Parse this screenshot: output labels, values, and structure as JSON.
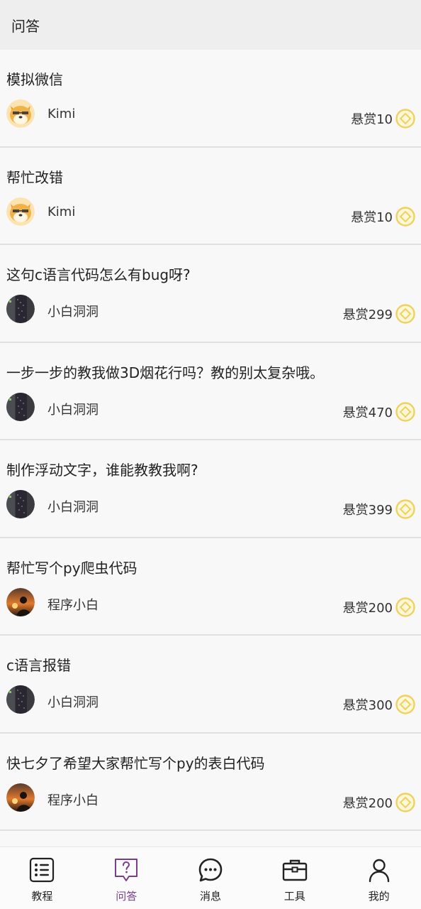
{
  "header": {
    "title": "问答"
  },
  "questions": [
    {
      "title": "模拟微信",
      "author": "Kimi",
      "avatar": "dog-avatar",
      "reward": "悬赏10"
    },
    {
      "title": "帮忙改错",
      "author": "Kimi",
      "avatar": "dog-avatar",
      "reward": "悬赏10"
    },
    {
      "title": "这句c语言代码怎么有bug呀?",
      "author": "小白洞洞",
      "avatar": "code-avatar",
      "reward": "悬赏299"
    },
    {
      "title": "一步一步的教我做3D烟花行吗？教的别太复杂哦。",
      "author": "小白洞洞",
      "avatar": "code-avatar",
      "reward": "悬赏470"
    },
    {
      "title": "制作浮动文字，谁能教教我啊?",
      "author": "小白洞洞",
      "avatar": "code-avatar",
      "reward": "悬赏399"
    },
    {
      "title": "帮忙写个py爬虫代码",
      "author": "程序小白",
      "avatar": "sunset-avatar",
      "reward": "悬赏200"
    },
    {
      "title": "c语言报错",
      "author": "小白洞洞",
      "avatar": "code-avatar",
      "reward": "悬赏300"
    },
    {
      "title": "快七夕了希望大家帮忙写个py的表白代码",
      "author": "程序小白",
      "avatar": "sunset-avatar",
      "reward": "悬赏200"
    }
  ],
  "tabs": [
    {
      "label": "教程",
      "icon": "list-icon",
      "active": false
    },
    {
      "label": "问答",
      "icon": "question-icon",
      "active": true
    },
    {
      "label": "消息",
      "icon": "chat-icon",
      "active": false
    },
    {
      "label": "工具",
      "icon": "toolbox-icon",
      "active": false
    },
    {
      "label": "我的",
      "icon": "person-icon",
      "active": false
    }
  ],
  "colors": {
    "accent": "#7a3c8c",
    "coin": "#f0d060",
    "header_bg": "#eeeeee"
  }
}
